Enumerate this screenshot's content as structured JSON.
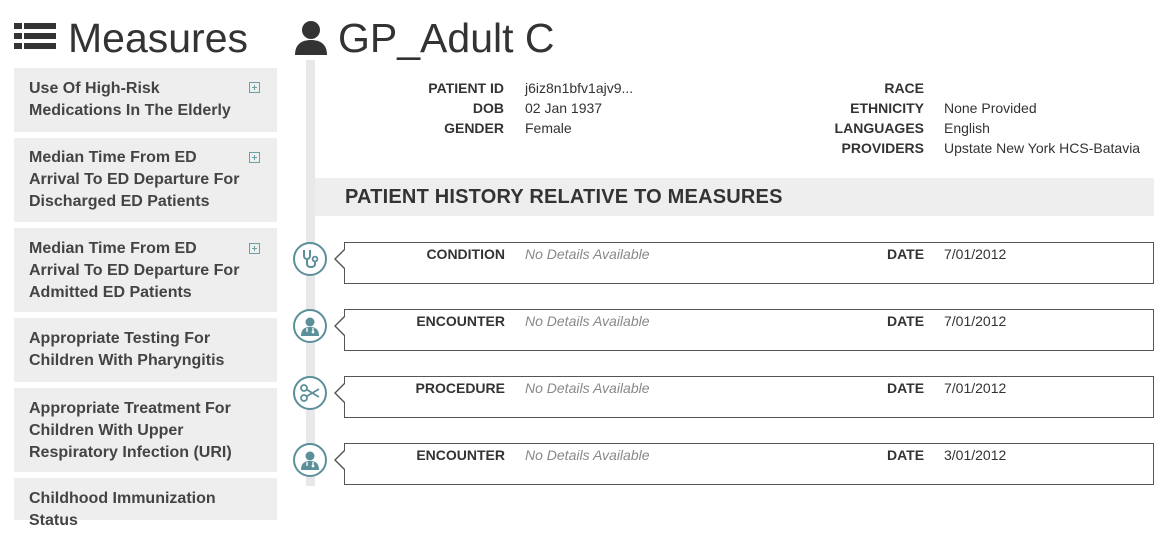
{
  "sidebar": {
    "title": "Measures",
    "icon": "list-icon",
    "items": [
      {
        "label": "Use Of High-Risk Medications In The Elderly",
        "expandable": true
      },
      {
        "label": "Median Time From ED Arrival To ED Departure For Discharged ED Patients",
        "expandable": true
      },
      {
        "label": "Median Time From ED Arrival To ED Departure For Admitted ED Patients",
        "expandable": true
      },
      {
        "label": "Appropriate Testing For Children With Pharyngitis",
        "expandable": false
      },
      {
        "label": "Appropriate Treatment For Children With Upper Respiratory Infection (URI)",
        "expandable": false
      },
      {
        "label": "Childhood Immunization Status",
        "expandable": false
      }
    ]
  },
  "patient": {
    "name": "GP_Adult C",
    "icon": "user-icon",
    "fields_left": [
      {
        "label": "PATIENT ID",
        "value": "j6iz8n1bfv1ajv9..."
      },
      {
        "label": "DOB",
        "value": "02 Jan 1937"
      },
      {
        "label": "GENDER",
        "value": "Female"
      }
    ],
    "fields_right": [
      {
        "label": "RACE",
        "value": ""
      },
      {
        "label": "ETHNICITY",
        "value": "None Provided"
      },
      {
        "label": "LANGUAGES",
        "value": "English"
      },
      {
        "label": "PROVIDERS",
        "value": "Upstate New York HCS-Batavia"
      }
    ]
  },
  "history": {
    "title": "PATIENT HISTORY RELATIVE TO MEASURES",
    "date_label": "DATE",
    "events": [
      {
        "type": "CONDITION",
        "detail": "No Details Available",
        "date": "7/01/2012",
        "icon": "stethoscope-icon"
      },
      {
        "type": "ENCOUNTER",
        "detail": "No Details Available",
        "date": "7/01/2012",
        "icon": "doctor-icon"
      },
      {
        "type": "PROCEDURE",
        "detail": "No Details Available",
        "date": "7/01/2012",
        "icon": "scissors-icon"
      },
      {
        "type": "ENCOUNTER",
        "detail": "No Details Available",
        "date": "3/01/2012",
        "icon": "doctor-icon"
      }
    ]
  },
  "colors": {
    "accent": "#5b8f99",
    "card_bg": "#eeeeee",
    "text": "#333333"
  }
}
